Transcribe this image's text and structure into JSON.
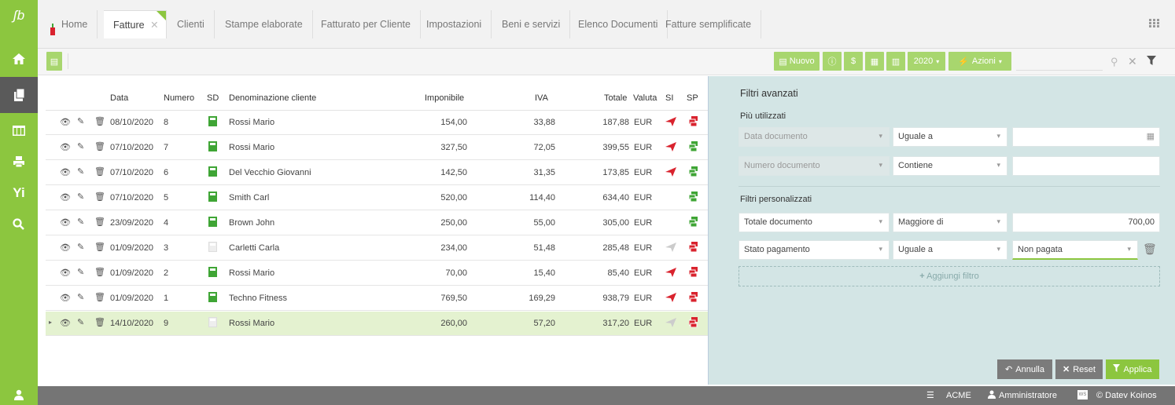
{
  "app": {
    "logo": "ʃb"
  },
  "sidebar": {
    "items": [
      {
        "icon": "home-icon",
        "glyph": "⌂"
      },
      {
        "icon": "documents-icon",
        "glyph": "❐"
      },
      {
        "icon": "table-icon",
        "glyph": "▦"
      },
      {
        "icon": "printer-icon",
        "glyph": "▤"
      },
      {
        "icon": "tools-icon",
        "glyph": "Y"
      },
      {
        "icon": "search-icon",
        "glyph": "⚲"
      }
    ],
    "user_icon": "user-icon"
  },
  "tabs": [
    {
      "label": "Home"
    },
    {
      "label": "Fatture"
    },
    {
      "label": "Clienti"
    },
    {
      "label": "Stampe elaborate"
    },
    {
      "label": "Fatturato per Cliente"
    },
    {
      "label": "Impostazioni"
    },
    {
      "label": "Beni e servizi"
    },
    {
      "label": "Elenco Documenti"
    },
    {
      "label": "Fatture semplificate"
    }
  ],
  "toolbar": {
    "new_label": "Nuovo",
    "year_label": "2020",
    "actions_label": "Azioni"
  },
  "table": {
    "columns": [
      "Data",
      "Numero",
      "SD",
      "Denominazione cliente",
      "Imponibile",
      "IVA",
      "Totale",
      "Valuta",
      "SI",
      "SP"
    ],
    "rows": [
      {
        "data": "08/10/2020",
        "numero": "8",
        "cliente": "Rossi Mario",
        "imponibile": "154,00",
        "iva": "33,88",
        "totale": "187,88",
        "valuta": "EUR",
        "sd": "green",
        "si": "red",
        "sp": "red"
      },
      {
        "data": "07/10/2020",
        "numero": "7",
        "cliente": "Rossi Mario",
        "imponibile": "327,50",
        "iva": "72,05",
        "totale": "399,55",
        "valuta": "EUR",
        "sd": "green",
        "si": "red",
        "sp": "green"
      },
      {
        "data": "07/10/2020",
        "numero": "6",
        "cliente": "Del Vecchio Giovanni",
        "imponibile": "142,50",
        "iva": "31,35",
        "totale": "173,85",
        "valuta": "EUR",
        "sd": "green",
        "si": "red",
        "sp": "green"
      },
      {
        "data": "07/10/2020",
        "numero": "5",
        "cliente": "Smith Carl",
        "imponibile": "520,00",
        "iva": "114,40",
        "totale": "634,40",
        "valuta": "EUR",
        "sd": "green",
        "si": "none",
        "sp": "green"
      },
      {
        "data": "23/09/2020",
        "numero": "4",
        "cliente": "Brown John",
        "imponibile": "250,00",
        "iva": "55,00",
        "totale": "305,00",
        "valuta": "EUR",
        "sd": "green",
        "si": "none",
        "sp": "green"
      },
      {
        "data": "01/09/2020",
        "numero": "3",
        "cliente": "Carletti Carla",
        "imponibile": "234,00",
        "iva": "51,48",
        "totale": "285,48",
        "valuta": "EUR",
        "sd": "gray",
        "si": "gray",
        "sp": "red"
      },
      {
        "data": "01/09/2020",
        "numero": "2",
        "cliente": "Rossi Mario",
        "imponibile": "70,00",
        "iva": "15,40",
        "totale": "85,40",
        "valuta": "EUR",
        "sd": "green",
        "si": "red",
        "sp": "red"
      },
      {
        "data": "01/09/2020",
        "numero": "1",
        "cliente": "Techno Fitness",
        "imponibile": "769,50",
        "iva": "169,29",
        "totale": "938,79",
        "valuta": "EUR",
        "sd": "green",
        "si": "red",
        "sp": "red"
      },
      {
        "data": "14/10/2020",
        "numero": "9",
        "cliente": "Rossi Mario",
        "imponibile": "260,00",
        "iva": "57,20",
        "totale": "317,20",
        "valuta": "EUR",
        "sd": "gray",
        "si": "gray",
        "sp": "red",
        "selected": true
      }
    ]
  },
  "filters": {
    "title": "Filtri avanzati",
    "most_used_title": "Più utilizzati",
    "most_used": [
      {
        "field": "Data documento",
        "op": "Uguale a",
        "value": ""
      },
      {
        "field": "Numero documento",
        "op": "Contiene",
        "value": ""
      }
    ],
    "custom_title": "Filtri personalizzati",
    "custom": [
      {
        "field": "Totale documento",
        "op": "Maggiore di",
        "value": "700,00"
      },
      {
        "field": "Stato pagamento",
        "op": "Uguale a",
        "value": "Non pagata"
      }
    ],
    "add_label": "Aggiungi filtro",
    "cancel_label": "Annulla",
    "reset_label": "Reset",
    "apply_label": "Applica"
  },
  "status": {
    "company": "ACME",
    "user": "Amministratore",
    "ws_badge": "WS",
    "copyright": "© Datev Koinos"
  },
  "colors": {
    "brand_green": "#8cc63f",
    "red": "#d9232e",
    "green": "#3fa535",
    "gray": "#cccccc"
  }
}
